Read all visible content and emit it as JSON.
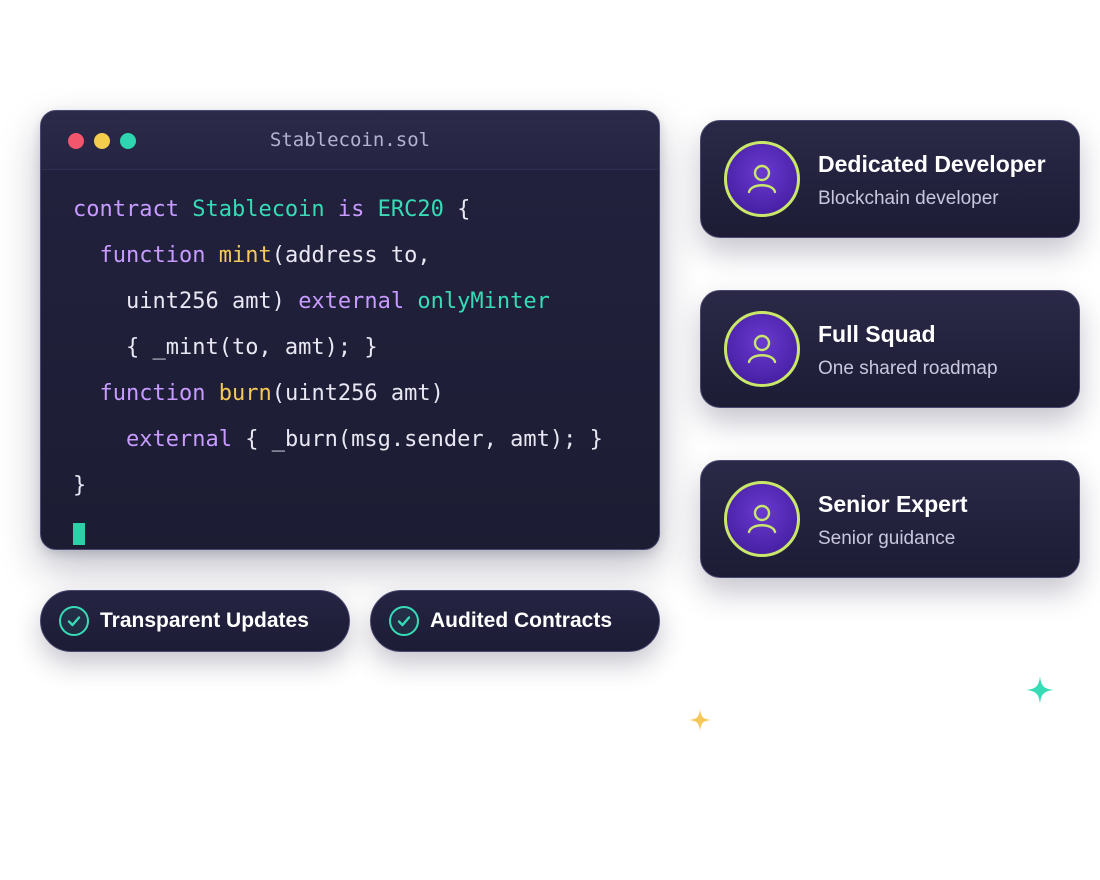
{
  "editor": {
    "filename": "Stablecoin.sol",
    "code": {
      "l1": {
        "kw1": "contract",
        "name": "Stablecoin",
        "kw2": "is",
        "base": "ERC20",
        "brace": "{"
      },
      "l2": {
        "kw": "function",
        "fn": "mint",
        "rest": "(address to,"
      },
      "l3": {
        "plain": "uint256 amt)",
        "kw": "external",
        "mod": "onlyMinter"
      },
      "l4": {
        "plain": "{ _mint(to, amt); }"
      },
      "l5": {
        "kw": "function",
        "fn": "burn",
        "rest": "(uint256 amt)"
      },
      "l6": {
        "kw": "external",
        "rest": "{ _burn(msg.sender, amt); }"
      },
      "l7": {
        "plain": "}"
      }
    }
  },
  "badges": [
    {
      "label": "Transparent Updates",
      "icon": "check-icon"
    },
    {
      "label": "Audited Contracts",
      "icon": "check-icon"
    }
  ],
  "cards": [
    {
      "title": "Dedicated Developer",
      "subtitle": "Blockchain developer",
      "icon": "user-icon"
    },
    {
      "title": "Full Squad",
      "subtitle": "One shared roadmap",
      "icon": "user-icon"
    },
    {
      "title": "Senior Expert",
      "subtitle": "Senior guidance",
      "icon": "user-icon"
    }
  ],
  "colors": {
    "keyword": "#c79bff",
    "type": "#36dcb6",
    "function": "#f5c85a",
    "accent_green": "#2fd5b0",
    "avatar_ring": "#c9e86a",
    "panel": "#1d1c35"
  }
}
